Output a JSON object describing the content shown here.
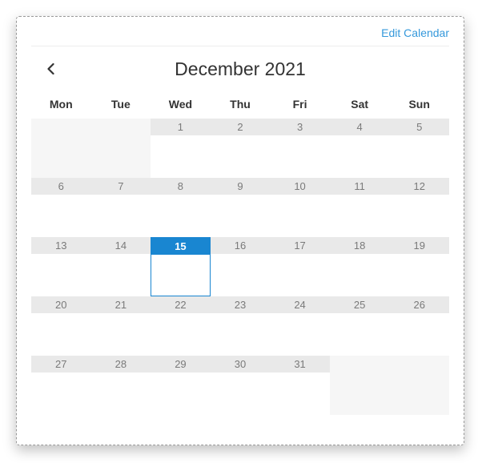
{
  "topbar": {
    "edit_label": "Edit Calendar"
  },
  "header": {
    "title": "December 2021"
  },
  "daysOfWeek": [
    "Mon",
    "Tue",
    "Wed",
    "Thu",
    "Fri",
    "Sat",
    "Sun"
  ],
  "selectedDay": 15,
  "weeks": [
    [
      "",
      "",
      "1",
      "2",
      "3",
      "4",
      "5"
    ],
    [
      "6",
      "7",
      "8",
      "9",
      "10",
      "11",
      "12"
    ],
    [
      "13",
      "14",
      "15",
      "16",
      "17",
      "18",
      "19"
    ],
    [
      "20",
      "21",
      "22",
      "23",
      "24",
      "25",
      "26"
    ],
    [
      "27",
      "28",
      "29",
      "30",
      "31",
      "",
      ""
    ]
  ]
}
